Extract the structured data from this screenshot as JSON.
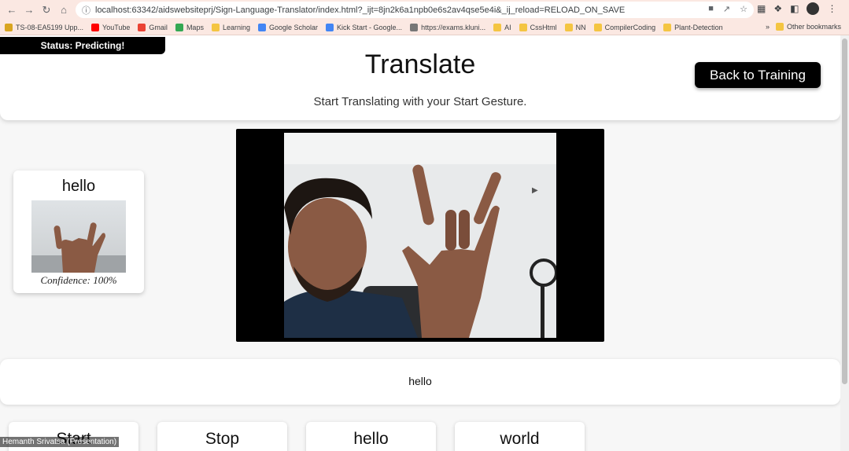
{
  "browser": {
    "url": "localhost:63342/aidswebsiteprj/Sign-Language-Translator/index.html?_ijt=8jn2k6a1npb0e6s2av4qse5e4i&_ij_reload=RELOAD_ON_SAVE",
    "bookmarks": [
      "TS-08-EA5199 Upp...",
      "YouTube",
      "Gmail",
      "Maps",
      "Learning",
      "Google Scholar",
      "Kick Start - Google...",
      "https://exams.kluni...",
      "AI",
      "CssHtml",
      "NN",
      "CompilerCoding",
      "Plant-Detection"
    ],
    "more_label": "»",
    "other_bookmarks": "Other bookmarks"
  },
  "page": {
    "status": "Status: Predicting!",
    "title": "Translate",
    "subtitle": "Start Translating with your Start Gesture.",
    "back_button": "Back to Training",
    "prediction_card": {
      "word": "hello",
      "confidence": "Confidence: 100%"
    },
    "output_text": "hello",
    "gestures": [
      "Start",
      "Stop",
      "hello",
      "world"
    ],
    "presenter_overlay": "Hemanth Srivatsa (Presentation)"
  },
  "colors": {
    "chrome_bg": "#fbe8e2",
    "accent": "#000000",
    "page_bg": "#f7f7f7"
  }
}
